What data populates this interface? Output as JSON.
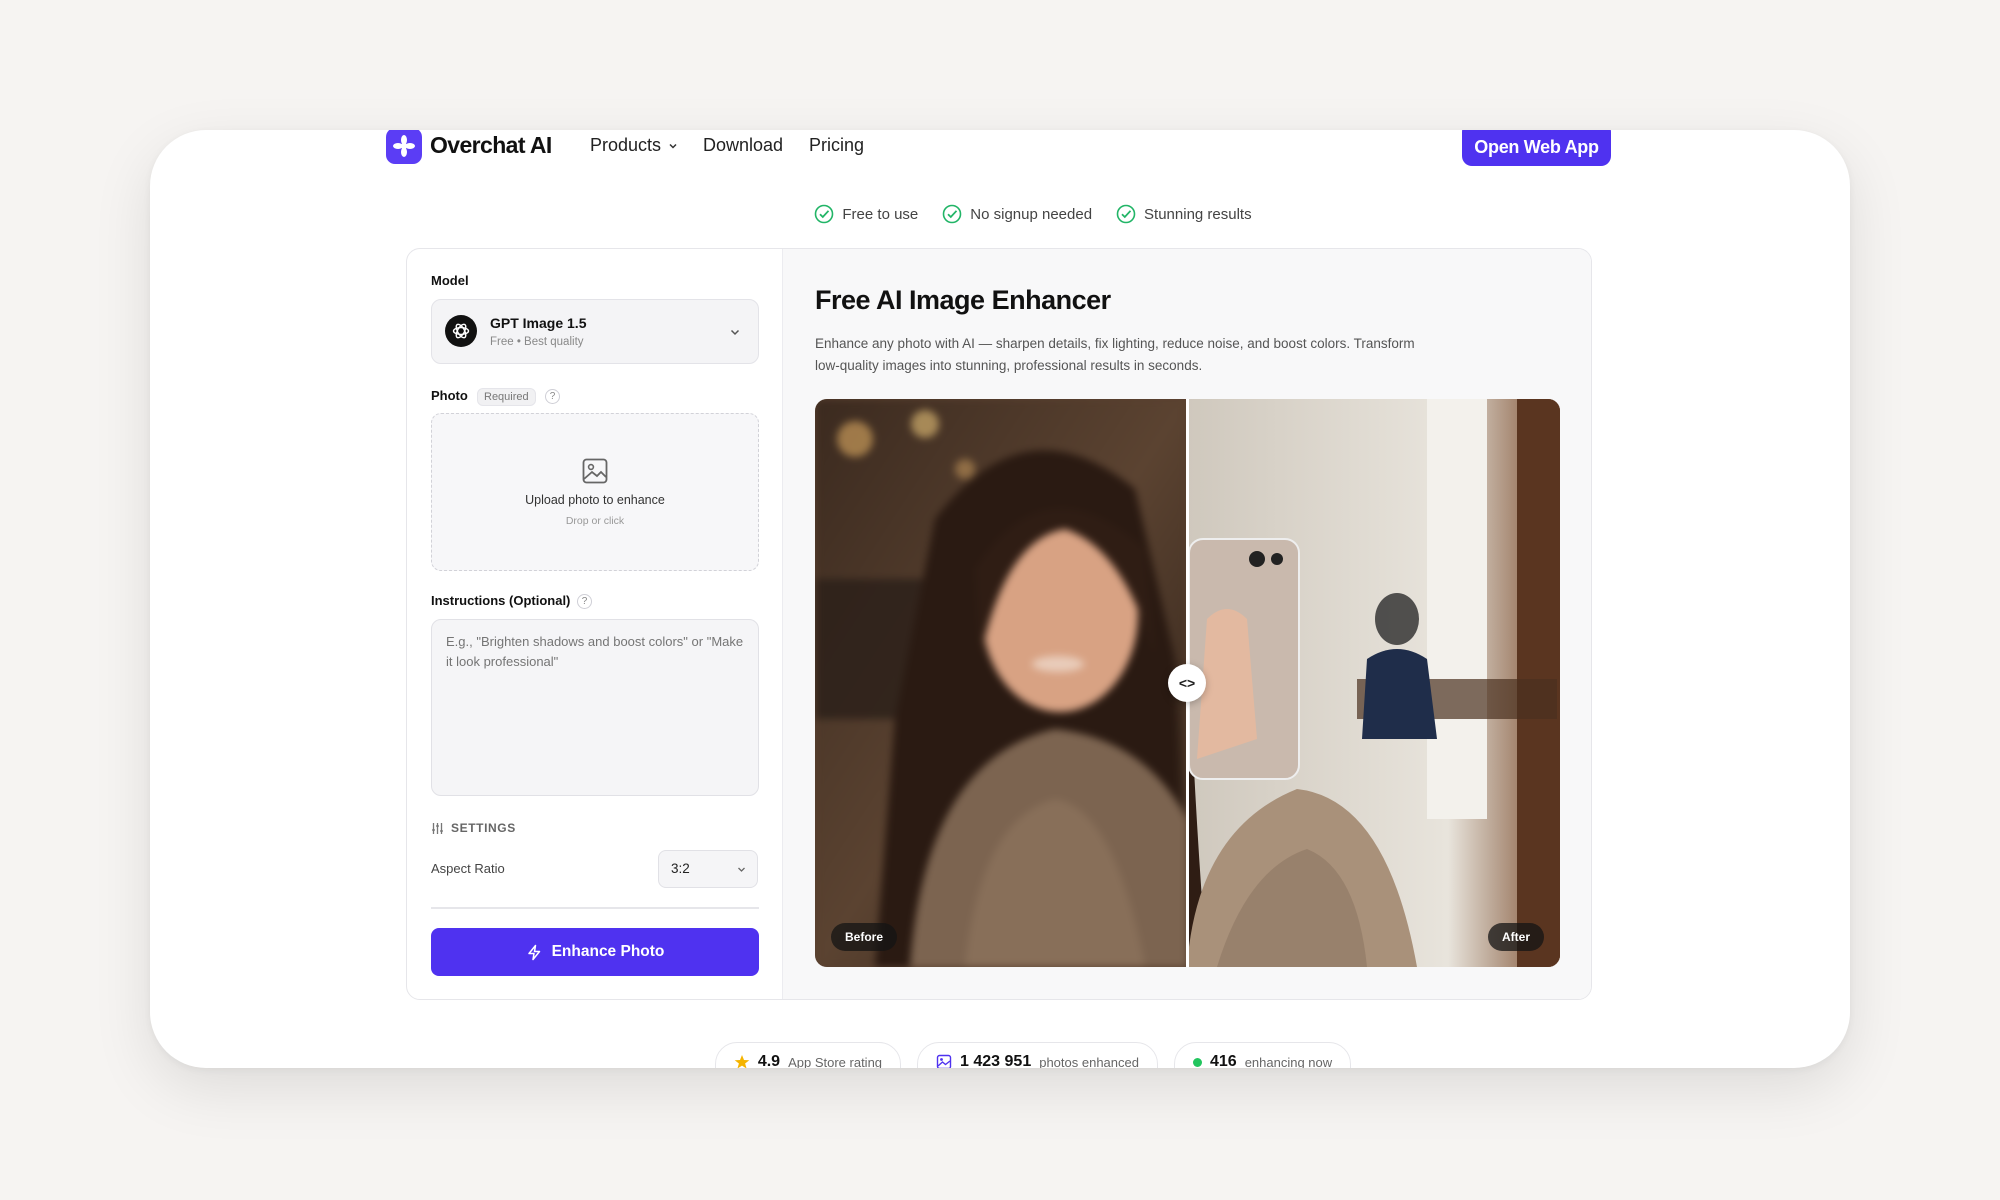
{
  "brand": {
    "name": "Overchat AI",
    "accent": "#4f32f0"
  },
  "nav": {
    "items": [
      {
        "label": "Products",
        "has_dropdown": true
      },
      {
        "label": "Download"
      },
      {
        "label": "Pricing"
      }
    ],
    "cta_label": "Open Web App"
  },
  "features": [
    "Free to use",
    "No signup needed",
    "Stunning results"
  ],
  "form": {
    "model_label": "Model",
    "model_name": "GPT Image 1.5",
    "model_sub": "Free • Best quality",
    "photo_label": "Photo",
    "photo_required": "Required",
    "help_glyph": "?",
    "upload_title": "Upload photo to enhance",
    "upload_sub": "Drop or click",
    "instructions_label": "Instructions (Optional)",
    "instructions_placeholder": "E.g., \"Brighten shadows and boost colors\" or \"Make it look professional\"",
    "settings_label": "SETTINGS",
    "aspect_label": "Aspect Ratio",
    "aspect_value": "3:2",
    "enhance_label": "Enhance Photo"
  },
  "hero": {
    "title": "Free AI Image Enhancer",
    "description": "Enhance any photo with AI — sharpen details, fix lighting, reduce noise, and boost colors. Transform low-quality images into stunning, professional results in seconds.",
    "before_label": "Before",
    "after_label": "After",
    "handle_glyph": "<>"
  },
  "stats": [
    {
      "value": "4.9",
      "label": "App Store rating",
      "icon": "star-icon"
    },
    {
      "value": "1 423 951",
      "label": "photos enhanced",
      "icon": "image-icon"
    },
    {
      "value": "416",
      "label": "enhancing now",
      "icon": "live-dot-icon"
    }
  ]
}
